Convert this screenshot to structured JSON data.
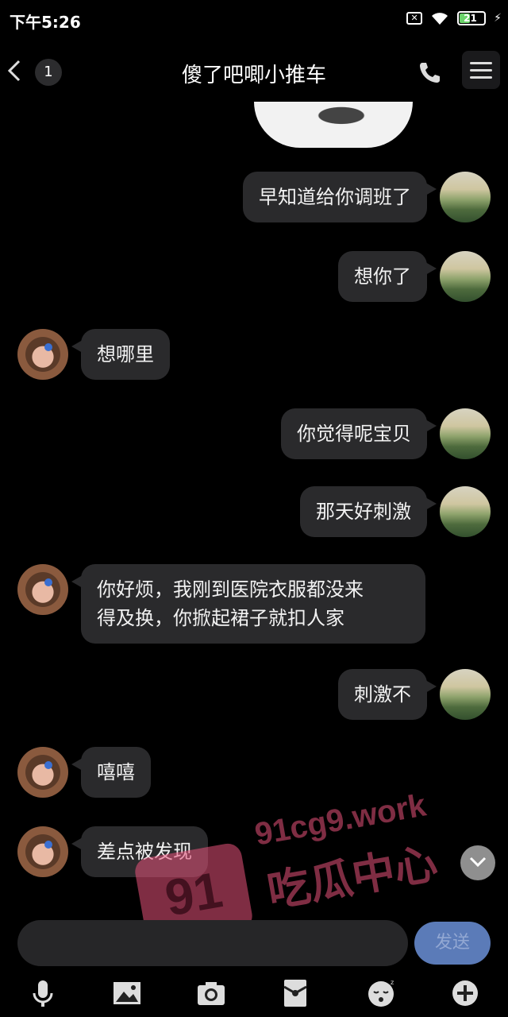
{
  "status_bar": {
    "time": "下午5:26",
    "battery": "21"
  },
  "header": {
    "unread_count": "1",
    "title": "傻了吧唧小推车"
  },
  "messages": [
    {
      "side": "me",
      "text": "早知道给你调班了"
    },
    {
      "side": "me",
      "text": "想你了"
    },
    {
      "side": "her",
      "text": "想哪里"
    },
    {
      "side": "me",
      "text": "你觉得呢宝贝"
    },
    {
      "side": "me",
      "text": "那天好刺激"
    },
    {
      "side": "her",
      "line1": "你好烦，我刚到医院衣服都没来",
      "line2": "得及换，你掀起裙子就扣人家"
    },
    {
      "side": "me",
      "text": "刺激不"
    },
    {
      "side": "her",
      "text": "嘻嘻"
    },
    {
      "side": "her",
      "text": "差点被发现"
    }
  ],
  "watermark": {
    "logo": "91",
    "url": "91cg9.work",
    "name": "吃瓜中心"
  },
  "input": {
    "send_label": "发送"
  },
  "toolbar": {
    "icons": [
      "mic-icon",
      "image-icon",
      "camera-icon",
      "red-envelope-icon",
      "emoji-icon",
      "plus-icon"
    ]
  }
}
